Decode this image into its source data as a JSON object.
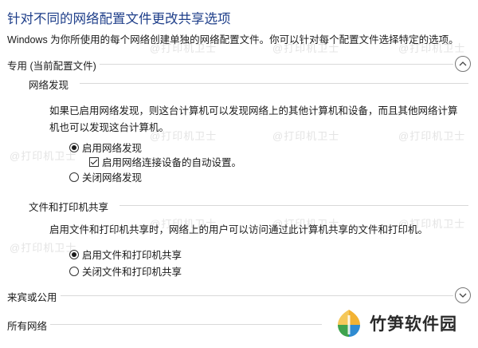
{
  "header": {
    "title": "针对不同的网络配置文件更改共享选项",
    "subtitle": "Windows 为你所使用的每个网络创建单独的网络配置文件。你可以针对每个配置文件选择特定的选项。"
  },
  "private_profile": {
    "label": "专用 (当前配置文件)",
    "expanded": true,
    "network_discovery": {
      "heading": "网络发现",
      "description": "如果已启用网络发现，则这台计算机可以发现网络上的其他计算机和设备，而且其他网络计算机也可以发现这台计算机。",
      "options": [
        {
          "label": "启用网络发现",
          "selected": true
        },
        {
          "label": "关闭网络发现",
          "selected": false
        }
      ],
      "auto_setup": {
        "label": "启用网络连接设备的自动设置。",
        "checked": true
      }
    },
    "file_printer_sharing": {
      "heading": "文件和打印机共享",
      "description": "启用文件和打印机共享时，网络上的用户可以访问通过此计算机共享的文件和打印机。",
      "options": [
        {
          "label": "启用文件和打印机共享",
          "selected": true
        },
        {
          "label": "关闭文件和打印机共享",
          "selected": false
        }
      ]
    }
  },
  "guest_profile": {
    "label": "来宾或公用",
    "expanded": false
  },
  "all_networks": {
    "label": "所有网络"
  },
  "watermark": {
    "text": "@打印机卫士"
  },
  "branding": {
    "logo_text": "竹笋软件园"
  },
  "colors": {
    "title": "#1f3f8a",
    "rule": "#d9d9d9"
  }
}
